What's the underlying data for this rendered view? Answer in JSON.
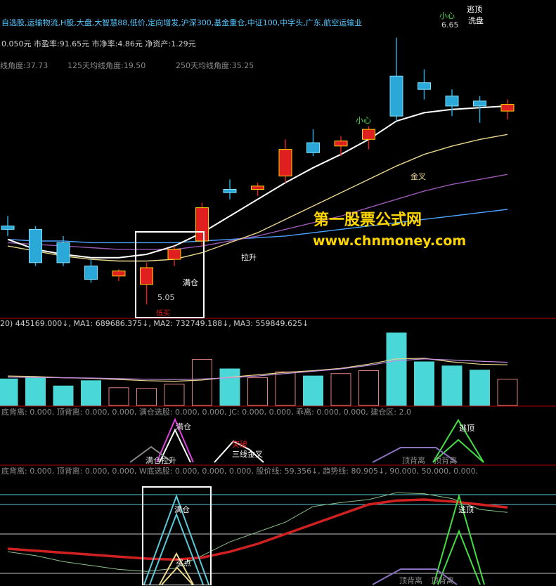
{
  "header": {
    "sectors": "自选股,运输物流,H股,大盘,大智慧88,低价,定向增发,沪深300,基金重仓,中证100,中字头,广东,航空运输业",
    "fundamentals": "0.050元  市盈率:91.65元  市净率:4.86元  净资产:1.29元",
    "angle1": "线角度:37.73",
    "angle2": "125天均线角度:19.50",
    "angle3": "250天均线角度:35.25"
  },
  "watermark": {
    "line1": "第一股票公式网",
    "line2": "www.chnmoney.com",
    "color": "#ffd700"
  },
  "main_annotations": {
    "escape_top": "逃顶",
    "careful_top": "小心",
    "wash": "洗盘",
    "price_high": "6.65",
    "careful_mid": "小心",
    "golden_cross": "金叉",
    "lift": "拉升",
    "full_position": "满仓",
    "price_low": "5.05",
    "low_marker": "低买"
  },
  "volume_header": "20) 445169.000↓, MA1: 689686.375↓, MA2: 732749.188↓, MA3: 559849.625↓",
  "panel2": {
    "header": "底背离: 0.000, 顶背离: 0.000,          0.000, 满仓选股: 0.000, 0.000, JC: 0.000,          0.000, 乖离: 0.000,          0.000, 建仓区: 2.0",
    "labels": [
      "满仓",
      "满仓拉升",
      "突破",
      "三线金叉",
      "逃顶",
      "顶背离",
      "顶背离"
    ]
  },
  "panel3": {
    "header": "底背离: 0.000, 顶背离: 0.000,          0.000, W底选股: 0.000, 0.000, 0.000, 股价线: 59.356↓, 趋势线: 80.905↓, 90.000, 50.000, 0.000,",
    "labels": [
      "满仓",
      "买点",
      "逃顶",
      "顶背离",
      "顶背离"
    ]
  },
  "colors": {
    "up": "#e02020",
    "down": "#2aa9d8",
    "ma_white": "#ffffff",
    "ma_yellow": "#e9d68a",
    "ma_purple": "#9b59b6",
    "ma_blue": "#4aa3ff",
    "volume": "#4ad7d7",
    "trend": "#d02020",
    "signal_green": "#44dd44"
  },
  "chart_data": [
    {
      "type": "candlestick",
      "candles": [
        {
          "o": 5.52,
          "h": 5.58,
          "l": 5.46,
          "c": 5.5
        },
        {
          "o": 5.5,
          "h": 5.52,
          "l": 5.28,
          "c": 5.3
        },
        {
          "o": 5.42,
          "h": 5.46,
          "l": 5.28,
          "c": 5.3
        },
        {
          "o": 5.28,
          "h": 5.32,
          "l": 5.18,
          "c": 5.2
        },
        {
          "o": 5.22,
          "h": 5.26,
          "l": 5.19,
          "c": 5.25
        },
        {
          "o": 5.17,
          "h": 5.3,
          "l": 5.05,
          "c": 5.27
        },
        {
          "o": 5.32,
          "h": 5.4,
          "l": 5.28,
          "c": 5.38
        },
        {
          "o": 5.43,
          "h": 5.66,
          "l": 5.4,
          "c": 5.63
        },
        {
          "o": 5.74,
          "h": 5.8,
          "l": 5.68,
          "c": 5.72
        },
        {
          "o": 5.74,
          "h": 5.78,
          "l": 5.7,
          "c": 5.76
        },
        {
          "o": 5.82,
          "h": 6.04,
          "l": 5.78,
          "c": 5.98
        },
        {
          "o": 6.02,
          "h": 6.1,
          "l": 5.94,
          "c": 5.96
        },
        {
          "o": 6.0,
          "h": 6.06,
          "l": 5.94,
          "c": 6.03
        },
        {
          "o": 6.04,
          "h": 6.12,
          "l": 5.98,
          "c": 6.1
        },
        {
          "o": 6.42,
          "h": 6.65,
          "l": 6.15,
          "c": 6.18
        },
        {
          "o": 6.38,
          "h": 6.46,
          "l": 6.28,
          "c": 6.34
        },
        {
          "o": 6.3,
          "h": 6.34,
          "l": 6.18,
          "c": 6.24
        },
        {
          "o": 6.27,
          "h": 6.3,
          "l": 6.14,
          "c": 6.24
        },
        {
          "o": 6.21,
          "h": 6.28,
          "l": 6.16,
          "c": 6.25
        }
      ],
      "ma_white": [
        5.44,
        5.38,
        5.35,
        5.33,
        5.33,
        5.35,
        5.4,
        5.48,
        5.58,
        5.68,
        5.78,
        5.87,
        5.95,
        6.04,
        6.15,
        6.2,
        6.22,
        6.23,
        6.24
      ],
      "ma_yellow": [
        5.4,
        5.37,
        5.34,
        5.32,
        5.31,
        5.31,
        5.32,
        5.36,
        5.42,
        5.48,
        5.56,
        5.64,
        5.72,
        5.8,
        5.88,
        5.95,
        6.0,
        6.04,
        6.07
      ],
      "ma_purple": [
        5.42,
        5.41,
        5.4,
        5.39,
        5.38,
        5.38,
        5.38,
        5.4,
        5.43,
        5.46,
        5.5,
        5.54,
        5.58,
        5.63,
        5.68,
        5.73,
        5.77,
        5.8,
        5.83
      ],
      "ma_blue": [
        5.44,
        5.43,
        5.43,
        5.42,
        5.42,
        5.42,
        5.42,
        5.43,
        5.44,
        5.45,
        5.46,
        5.48,
        5.5,
        5.52,
        5.54,
        5.56,
        5.58,
        5.6,
        5.62
      ]
    },
    {
      "type": "bar",
      "series": "volume",
      "values": [
        450000,
        480000,
        330000,
        420000,
        300000,
        290000,
        360000,
        780000,
        620000,
        470000,
        570000,
        500000,
        540000,
        590000,
        1230000,
        740000,
        670000,
        600000,
        445169
      ],
      "ma1": [
        500000,
        490000,
        470000,
        460000,
        440000,
        420000,
        410000,
        430000,
        480000,
        520000,
        560000,
        590000,
        630000,
        700000,
        790000,
        800000,
        740000,
        700000,
        689686
      ],
      "ma2": [
        480000,
        475000,
        470000,
        465000,
        455000,
        445000,
        440000,
        450000,
        470000,
        500000,
        540000,
        580000,
        620000,
        680000,
        760000,
        790000,
        770000,
        750000,
        732749
      ]
    },
    {
      "type": "line",
      "series": "trend",
      "values": [
        35,
        33,
        31,
        29,
        27,
        25,
        24,
        26,
        32,
        40,
        50,
        60,
        70,
        80,
        84,
        85,
        83,
        80,
        77
      ]
    },
    {
      "type": "line",
      "series": "price_line",
      "values": [
        32,
        28,
        22,
        18,
        14,
        12,
        15,
        28,
        42,
        52,
        62,
        78,
        82,
        85,
        92,
        91,
        86,
        75,
        72
      ]
    }
  ]
}
